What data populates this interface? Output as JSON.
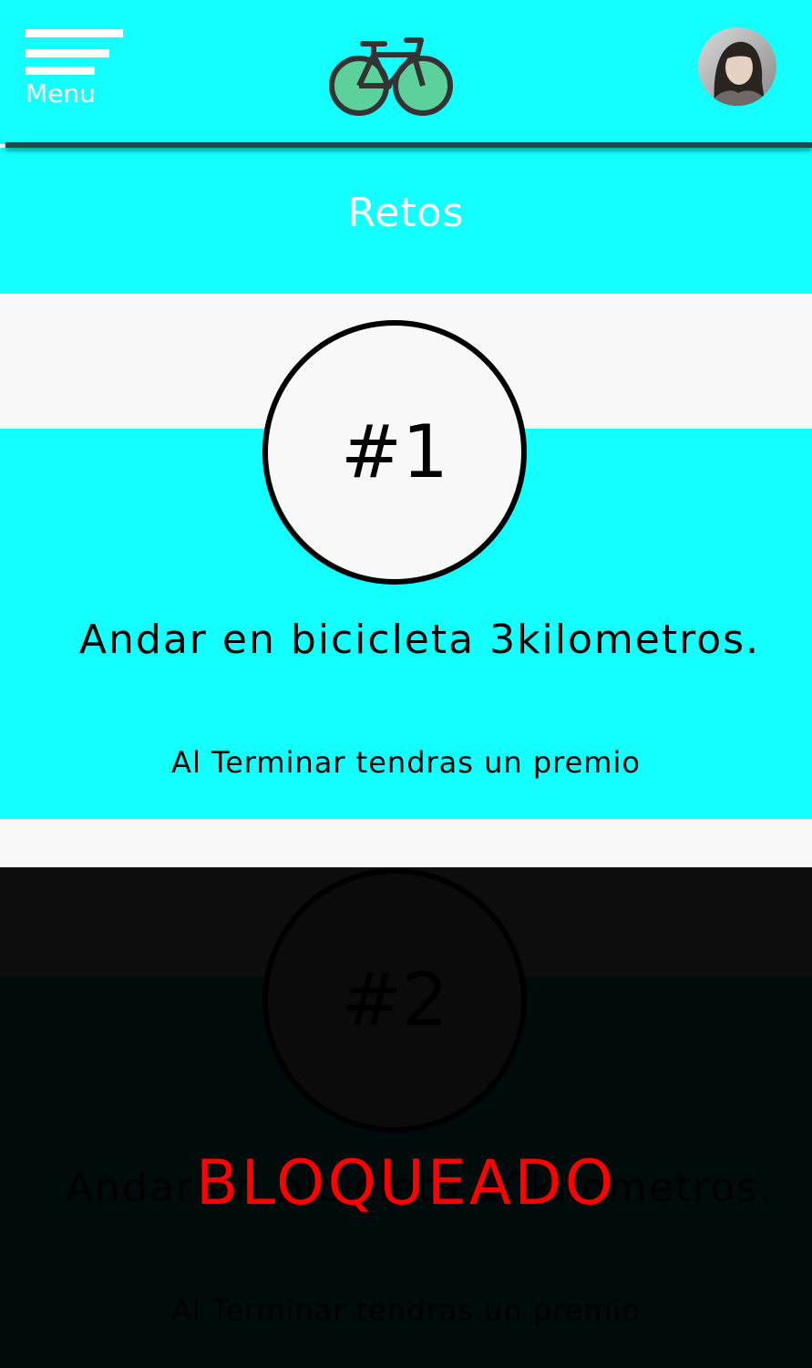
{
  "header": {
    "menu_label": "Menu",
    "logo_icon": "bicycle-icon",
    "avatar_icon": "user-avatar"
  },
  "page": {
    "title": "Retos"
  },
  "challenges": [
    {
      "number": "#1",
      "description": "Andar en bicicleta 3kilometros.",
      "reward": "Al Terminar tendras un premio",
      "locked": false
    },
    {
      "number": "#2",
      "description": "Andar en bicicleta 10kilometros.",
      "reward": "Al Terminar tendras un premio",
      "locked": true,
      "locked_label": "BLOQUEADO"
    }
  ],
  "colors": {
    "accent": "#14ffff",
    "locked_text": "#ff0000",
    "background": "#f8f8f8"
  }
}
